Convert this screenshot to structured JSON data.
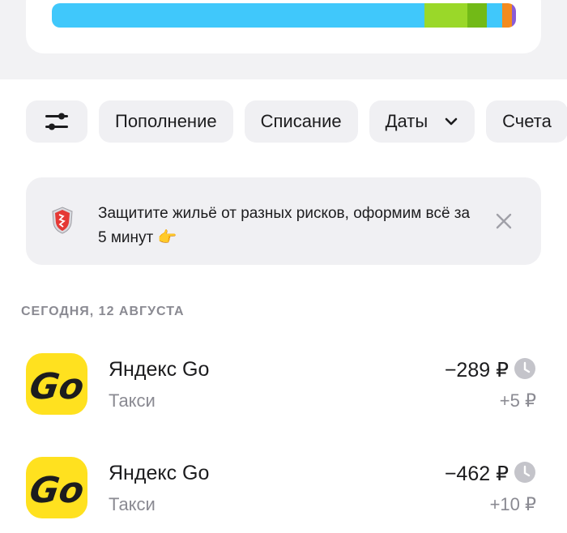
{
  "spend_bar": {
    "segments": [
      {
        "color": "#40c8fb",
        "share": 0.803
      },
      {
        "color": "#9ad829",
        "share": 0.092
      },
      {
        "color": "#72ba17",
        "share": 0.042
      },
      {
        "color": "#40c8fb",
        "share": 0.033
      },
      {
        "color": "#f38b1f",
        "share": 0.021
      },
      {
        "color": "#8b5cd6",
        "share": 0.009
      }
    ]
  },
  "filters": {
    "settings_icon": "sliders-icon",
    "replenish": "Пополнение",
    "debit": "Списание",
    "dates": "Даты",
    "accounts": "Счета"
  },
  "promo": {
    "icon": "shield-icon",
    "text": "Защитите жильё от разных рисков, оформим всё за 5 минут 👉"
  },
  "date_header": "СЕГОДНЯ, 12 АВГУСТА",
  "transactions": [
    {
      "title": "Яндекс Go",
      "subtitle": "Такси",
      "amount": "−289 ₽",
      "cashback": "+5 ₽",
      "logo_text": "Go"
    },
    {
      "title": "Яндекс Go",
      "subtitle": "Такси",
      "amount": "−462 ₽",
      "cashback": "+10 ₽",
      "logo_text": "Go"
    }
  ],
  "colors": {
    "accent_yellow": "#ffe11f",
    "muted_text": "#8a8a92",
    "chip_bg": "#f0f0f3"
  }
}
